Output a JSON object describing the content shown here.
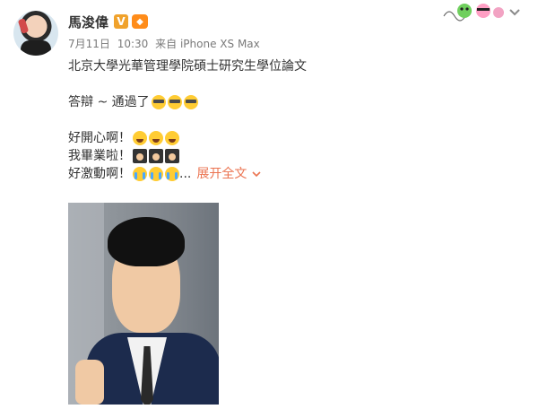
{
  "post": {
    "author_name": "馬浚偉",
    "meta": {
      "date": "7月11日",
      "time": "10:30",
      "source": "来自 iPhone XS Max"
    },
    "content": {
      "line1": "北京大學光華管理學院碩士研究生學位論文",
      "line2_text": "答辯 ~ 通過了",
      "line3_text": "好開心啊！",
      "line4_text": "我畢業啦！",
      "line5_text": "好激動啊！",
      "ellipsis": "...",
      "expand_label": "展开全文"
    },
    "icons": {
      "verified": "verified-v-icon",
      "gift": "gift-icon",
      "emoji_cool": "sunglasses-emoji",
      "emoji_laugh": "laugh-emoji",
      "emoji_grad": "graduate-emoji",
      "emoji_cry": "crying-emoji",
      "chevron": "chevron-down-icon"
    },
    "colors": {
      "expand_link": "#eb7350",
      "verified_badge": "#f0a22c"
    }
  }
}
